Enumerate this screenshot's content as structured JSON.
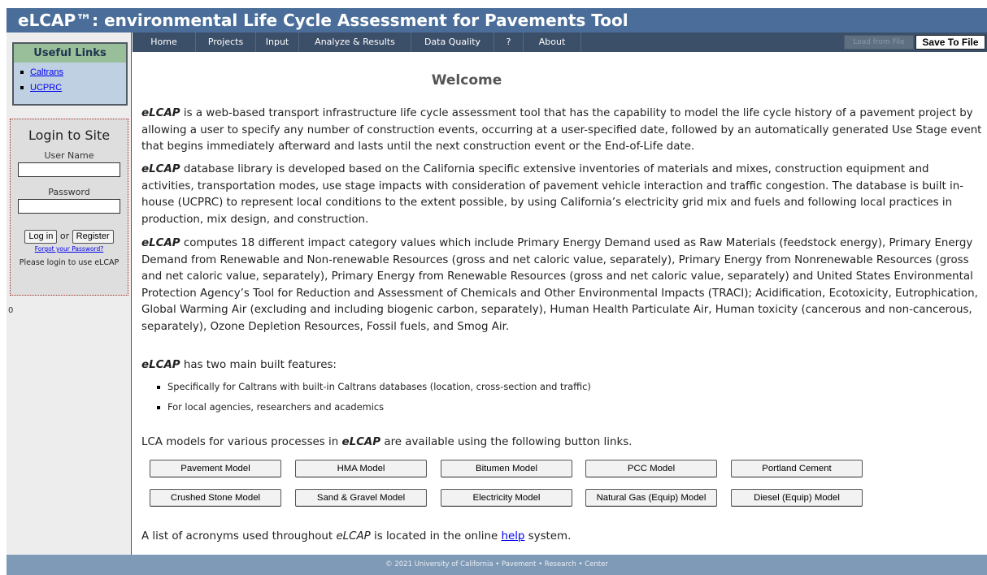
{
  "title": "eLCAP™: environmental Life Cycle Assessment for Pavements Tool",
  "nav": [
    "Home",
    "Projects",
    "Input",
    "Analyze & Results",
    "Data Quality",
    "?",
    "About"
  ],
  "toolbar": {
    "disabled_label": "Load from File",
    "save_label": "Save To File"
  },
  "useful_links": {
    "header": "Useful Links",
    "items": [
      "Caltrans",
      "UCPRC"
    ]
  },
  "login": {
    "title": "Login to Site",
    "username_label": "User Name",
    "password_label": "Password",
    "login_button": "Log in",
    "or_text": "or",
    "register_button": "Register",
    "forgot_link": "Forgot your Password?",
    "hint": "Please login to use eLCAP"
  },
  "counter": "0",
  "main": {
    "heading": "Welcome",
    "app_name": "eLCAP",
    "para1": " is a web-based transport infrastructure life cycle assessment tool that has the capability to model the life cycle history of a pavement project by allowing a user to specify any number of construction events, occurring at a user-specified date, followed by an automatically generated Use Stage event that begins immediately afterward and lasts until the next construction event or the End-of-Life date.",
    "para2": " database library is developed based on the California specific extensive inventories of materials and mixes, construction equipment and activities, transportation modes, use stage impacts with consideration of pavement vehicle interaction and traffic congestion. The database is built in-house (UCPRC) to represent local conditions to the extent possible, by using California’s electricity grid mix and fuels and following local practices in production, mix design, and construction.",
    "para3": " computes 18 different impact category values which include Primary Energy Demand used as Raw Materials (feedstock energy), Primary Energy Demand from Renewable and Non-renewable Resources (gross and net caloric value, separately), Primary Energy from Nonrenewable Resources (gross and net caloric value, separately), Primary Energy from Renewable Resources (gross and net caloric value, separately) and United States Environmental Protection Agency’s Tool for Reduction and Assessment of Chemicals and Other Environmental Impacts (TRACI); Acidification, Ecotoxicity, Eutrophication, Global Warming Air (excluding and including biogenic carbon, separately), Human Health Particulate Air, Human toxicity (cancerous and non-cancerous, separately), Ozone Depletion Resources, Fossil fuels, and Smog Air.",
    "features_intro": " has two main built features:",
    "features": [
      "Specifically for Caltrans with built-in Caltrans databases (location, cross-section and traffic)",
      "For local agencies, researchers and academics"
    ],
    "models_intro_a": "LCA models for various processes in ",
    "models_intro_b": " are available using the following button links.",
    "models_row1": [
      "Pavement Model",
      "HMA Model",
      "Bitumen Model",
      "PCC Model",
      "Portland Cement"
    ],
    "models_row2": [
      "Crushed Stone Model",
      "Sand & Gravel Model",
      "Electricity Model",
      "Natural Gas (Equip) Model",
      "Diesel (Equip) Model"
    ],
    "acronyms_a": "A list of acronyms used throughout ",
    "acronyms_b": " is located in the online ",
    "help_link": "help",
    "acronyms_c": " system."
  },
  "footer": "© 2021 University of California • Pavement • Research • Center"
}
